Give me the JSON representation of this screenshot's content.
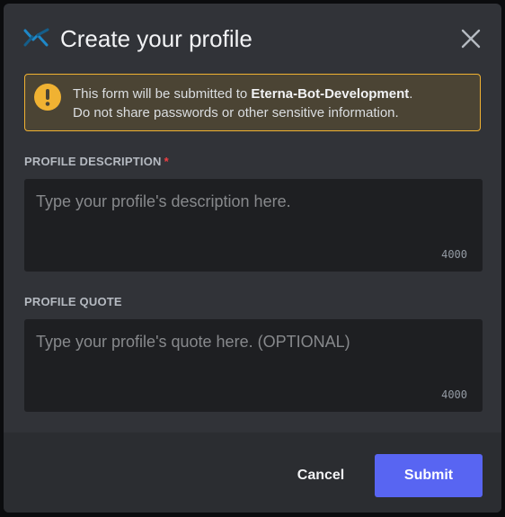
{
  "modal": {
    "title": "Create your profile",
    "app_icon": "bot-app-icon",
    "close_icon": "close-icon"
  },
  "warning": {
    "icon": "exclamation-icon",
    "prefix": "This form will be submitted to ",
    "app_name": "Eterna-Bot-Development",
    "suffix": ".",
    "line2": "Do not share passwords or other sensitive information."
  },
  "fields": [
    {
      "label": "PROFILE DESCRIPTION",
      "required_mark": "*",
      "placeholder": "Type your profile's description here.",
      "value": "",
      "counter": "4000"
    },
    {
      "label": "PROFILE QUOTE",
      "placeholder": "Type your profile's quote here. (OPTIONAL)",
      "value": "",
      "counter": "4000"
    }
  ],
  "footer": {
    "cancel_label": "Cancel",
    "submit_label": "Submit"
  },
  "colors": {
    "modal_bg": "#313338",
    "footer_bg": "#2b2d31",
    "input_bg": "#1e1f22",
    "warning_border": "#f0b232",
    "warning_bg": "#4b4434",
    "accent": "#5865f2",
    "required": "#f23f43"
  }
}
